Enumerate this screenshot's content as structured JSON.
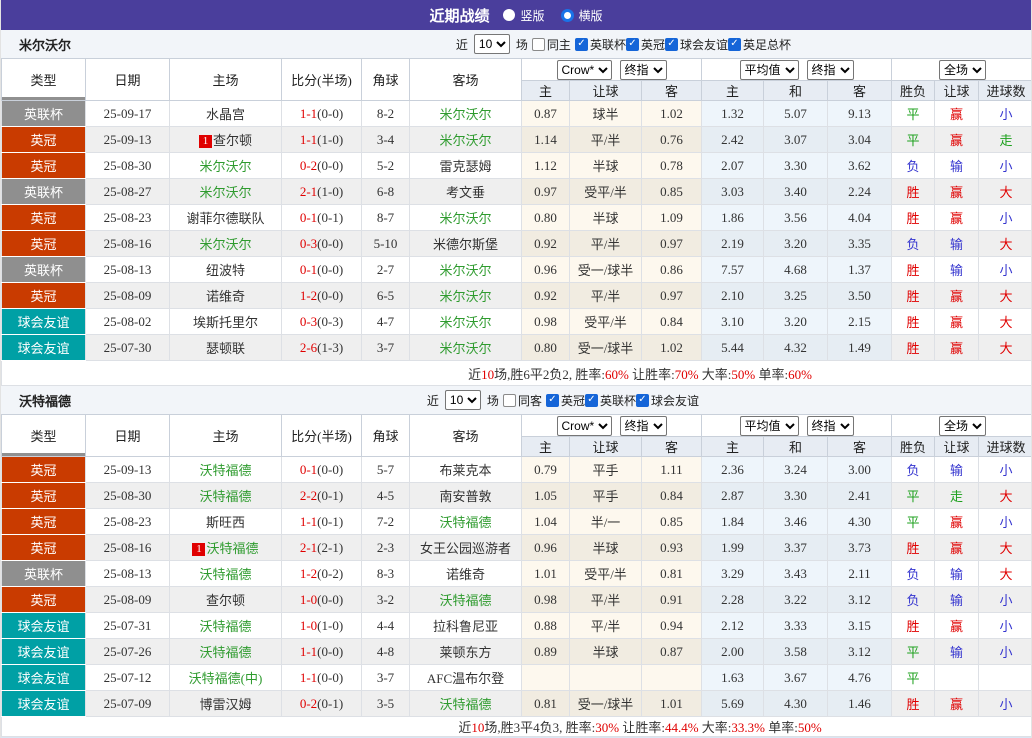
{
  "topbar": {
    "title": "近期战绩",
    "radio1": "竖版",
    "radio2": "横版"
  },
  "columns": [
    "类型",
    "日期",
    "主场",
    "比分(半场)",
    "角球",
    "客场"
  ],
  "subcolumns": [
    "主",
    "让球",
    "客",
    "主",
    "和",
    "客",
    "胜负",
    "让球",
    "进球数"
  ],
  "selects": {
    "odds_source": "Crow*",
    "final1": "终指",
    "average": "平均值",
    "final2": "终指",
    "scope": "全场",
    "recent_count": "10"
  },
  "filter_labels": {
    "recent": "近",
    "games": "场"
  },
  "league_colors": {
    "英联杯": "#8f8f8f",
    "英冠": "#c93b00",
    "球会友谊": "#00a0a5"
  },
  "result_colors": {
    "r": "#e00000",
    "g": "#1ca01c",
    "b": "#3434cf"
  },
  "accent_colors": {
    "topbar_purple": "#4a3e9c",
    "score_red": "#e00000",
    "team_green": "#2e9b2e",
    "checkbox_blue": "#1565d8"
  },
  "sections": [
    {
      "team": "米尔沃尔",
      "filter": {
        "same": "同主",
        "same_checked": false,
        "leagues": [
          "英联杯",
          "英冠",
          "球会友谊",
          "英足总杯"
        ]
      },
      "rows": [
        {
          "league": "英联杯",
          "date": "25-09-17",
          "home": {
            "name": "水晶宫",
            "green": false
          },
          "score": {
            "ft": "1-1",
            "ht": "(0-0)"
          },
          "corner": "8-2",
          "away": {
            "name": "米尔沃尔",
            "green": true
          },
          "crow": [
            "0.87",
            "球半",
            "1.02"
          ],
          "avg": [
            "1.32",
            "5.07",
            "9.13"
          ],
          "outcome": [
            {
              "t": "平",
              "c": "g"
            },
            {
              "t": "赢",
              "c": "r"
            },
            {
              "t": "小",
              "c": "b"
            }
          ]
        },
        {
          "league": "英冠",
          "date": "25-09-13",
          "home": {
            "name": "查尔顿",
            "green": false,
            "badge": "1"
          },
          "score": {
            "ft": "1-1",
            "ht": "(1-0)"
          },
          "corner": "3-4",
          "away": {
            "name": "米尔沃尔",
            "green": true
          },
          "crow": [
            "1.14",
            "平/半",
            "0.76"
          ],
          "avg": [
            "2.42",
            "3.07",
            "3.04"
          ],
          "outcome": [
            {
              "t": "平",
              "c": "g"
            },
            {
              "t": "赢",
              "c": "r"
            },
            {
              "t": "走",
              "c": "g"
            }
          ]
        },
        {
          "league": "英冠",
          "date": "25-08-30",
          "home": {
            "name": "米尔沃尔",
            "green": true
          },
          "score": {
            "ft": "0-2",
            "ht": "(0-0)"
          },
          "corner": "5-2",
          "away": {
            "name": "雷克瑟姆",
            "green": false
          },
          "crow": [
            "1.12",
            "半球",
            "0.78"
          ],
          "avg": [
            "2.07",
            "3.30",
            "3.62"
          ],
          "outcome": [
            {
              "t": "负",
              "c": "b"
            },
            {
              "t": "输",
              "c": "b"
            },
            {
              "t": "小",
              "c": "b"
            }
          ]
        },
        {
          "league": "英联杯",
          "date": "25-08-27",
          "home": {
            "name": "米尔沃尔",
            "green": true
          },
          "score": {
            "ft": "2-1",
            "ht": "(1-0)"
          },
          "corner": "6-8",
          "away": {
            "name": "考文垂",
            "green": false
          },
          "crow": [
            "0.97",
            "受平/半",
            "0.85"
          ],
          "avg": [
            "3.03",
            "3.40",
            "2.24"
          ],
          "outcome": [
            {
              "t": "胜",
              "c": "r"
            },
            {
              "t": "赢",
              "c": "r"
            },
            {
              "t": "大",
              "c": "r"
            }
          ]
        },
        {
          "league": "英冠",
          "date": "25-08-23",
          "home": {
            "name": "谢菲尔德联队",
            "green": false
          },
          "score": {
            "ft": "0-1",
            "ht": "(0-1)"
          },
          "corner": "8-7",
          "away": {
            "name": "米尔沃尔",
            "green": true
          },
          "crow": [
            "0.80",
            "半球",
            "1.09"
          ],
          "avg": [
            "1.86",
            "3.56",
            "4.04"
          ],
          "outcome": [
            {
              "t": "胜",
              "c": "r"
            },
            {
              "t": "赢",
              "c": "r"
            },
            {
              "t": "小",
              "c": "b"
            }
          ]
        },
        {
          "league": "英冠",
          "date": "25-08-16",
          "home": {
            "name": "米尔沃尔",
            "green": true
          },
          "score": {
            "ft": "0-3",
            "ht": "(0-0)"
          },
          "corner": "5-10",
          "away": {
            "name": "米德尔斯堡",
            "green": false
          },
          "crow": [
            "0.92",
            "平/半",
            "0.97"
          ],
          "avg": [
            "2.19",
            "3.20",
            "3.35"
          ],
          "outcome": [
            {
              "t": "负",
              "c": "b"
            },
            {
              "t": "输",
              "c": "b"
            },
            {
              "t": "大",
              "c": "r"
            }
          ]
        },
        {
          "league": "英联杯",
          "date": "25-08-13",
          "home": {
            "name": "纽波特",
            "green": false
          },
          "score": {
            "ft": "0-1",
            "ht": "(0-0)"
          },
          "corner": "2-7",
          "away": {
            "name": "米尔沃尔",
            "green": true
          },
          "crow": [
            "0.96",
            "受一/球半",
            "0.86"
          ],
          "avg": [
            "7.57",
            "4.68",
            "1.37"
          ],
          "outcome": [
            {
              "t": "胜",
              "c": "r"
            },
            {
              "t": "输",
              "c": "b"
            },
            {
              "t": "小",
              "c": "b"
            }
          ]
        },
        {
          "league": "英冠",
          "date": "25-08-09",
          "home": {
            "name": "诺维奇",
            "green": false
          },
          "score": {
            "ft": "1-2",
            "ht": "(0-0)"
          },
          "corner": "6-5",
          "away": {
            "name": "米尔沃尔",
            "green": true
          },
          "crow": [
            "0.92",
            "平/半",
            "0.97"
          ],
          "avg": [
            "2.10",
            "3.25",
            "3.50"
          ],
          "outcome": [
            {
              "t": "胜",
              "c": "r"
            },
            {
              "t": "赢",
              "c": "r"
            },
            {
              "t": "大",
              "c": "r"
            }
          ]
        },
        {
          "league": "球会友谊",
          "date": "25-08-02",
          "home": {
            "name": "埃斯托里尔",
            "green": false
          },
          "score": {
            "ft": "0-3",
            "ht": "(0-3)"
          },
          "corner": "4-7",
          "away": {
            "name": "米尔沃尔",
            "green": true
          },
          "crow": [
            "0.98",
            "受平/半",
            "0.84"
          ],
          "avg": [
            "3.10",
            "3.20",
            "2.15"
          ],
          "outcome": [
            {
              "t": "胜",
              "c": "r"
            },
            {
              "t": "赢",
              "c": "r"
            },
            {
              "t": "大",
              "c": "r"
            }
          ]
        },
        {
          "league": "球会友谊",
          "date": "25-07-30",
          "home": {
            "name": "瑟顿联",
            "green": false
          },
          "score": {
            "ft": "2-6",
            "ht": "(1-3)"
          },
          "corner": "3-7",
          "away": {
            "name": "米尔沃尔",
            "green": true
          },
          "crow": [
            "0.80",
            "受一/球半",
            "1.02"
          ],
          "avg": [
            "5.44",
            "4.32",
            "1.49"
          ],
          "outcome": [
            {
              "t": "胜",
              "c": "r"
            },
            {
              "t": "赢",
              "c": "r"
            },
            {
              "t": "大",
              "c": "r"
            }
          ]
        }
      ],
      "summary": [
        {
          "t": "近"
        },
        {
          "t": "10",
          "red": true
        },
        {
          "t": "场,胜6平2负2, 胜率:"
        },
        {
          "t": "60%",
          "red": true
        },
        {
          "t": " 让胜率:"
        },
        {
          "t": "70%",
          "red": true
        },
        {
          "t": " 大率:"
        },
        {
          "t": "50%",
          "red": true
        },
        {
          "t": " 单率:"
        },
        {
          "t": "60%",
          "red": true
        }
      ]
    },
    {
      "team": "沃特福德",
      "filter": {
        "same": "同客",
        "same_checked": false,
        "leagues": [
          "英冠",
          "英联杯",
          "球会友谊"
        ]
      },
      "rows": [
        {
          "league": "英冠",
          "date": "25-09-13",
          "home": {
            "name": "沃特福德",
            "green": true
          },
          "score": {
            "ft": "0-1",
            "ht": "(0-0)"
          },
          "corner": "5-7",
          "away": {
            "name": "布莱克本",
            "green": false
          },
          "crow": [
            "0.79",
            "平手",
            "1.11"
          ],
          "avg": [
            "2.36",
            "3.24",
            "3.00"
          ],
          "outcome": [
            {
              "t": "负",
              "c": "b"
            },
            {
              "t": "输",
              "c": "b"
            },
            {
              "t": "小",
              "c": "b"
            }
          ]
        },
        {
          "league": "英冠",
          "date": "25-08-30",
          "home": {
            "name": "沃特福德",
            "green": true
          },
          "score": {
            "ft": "2-2",
            "ht": "(0-1)"
          },
          "corner": "4-5",
          "away": {
            "name": "南安普敦",
            "green": false
          },
          "crow": [
            "1.05",
            "平手",
            "0.84"
          ],
          "avg": [
            "2.87",
            "3.30",
            "2.41"
          ],
          "outcome": [
            {
              "t": "平",
              "c": "g"
            },
            {
              "t": "走",
              "c": "g"
            },
            {
              "t": "大",
              "c": "r"
            }
          ]
        },
        {
          "league": "英冠",
          "date": "25-08-23",
          "home": {
            "name": "斯旺西",
            "green": false
          },
          "score": {
            "ft": "1-1",
            "ht": "(0-1)"
          },
          "corner": "7-2",
          "away": {
            "name": "沃特福德",
            "green": true
          },
          "crow": [
            "1.04",
            "半/一",
            "0.85"
          ],
          "avg": [
            "1.84",
            "3.46",
            "4.30"
          ],
          "outcome": [
            {
              "t": "平",
              "c": "g"
            },
            {
              "t": "赢",
              "c": "r"
            },
            {
              "t": "小",
              "c": "b"
            }
          ]
        },
        {
          "league": "英冠",
          "date": "25-08-16",
          "home": {
            "name": "沃特福德",
            "green": true,
            "badge": "1"
          },
          "score": {
            "ft": "2-1",
            "ht": "(2-1)"
          },
          "corner": "2-3",
          "away": {
            "name": "女王公园巡游者",
            "green": false
          },
          "crow": [
            "0.96",
            "半球",
            "0.93"
          ],
          "avg": [
            "1.99",
            "3.37",
            "3.73"
          ],
          "outcome": [
            {
              "t": "胜",
              "c": "r"
            },
            {
              "t": "赢",
              "c": "r"
            },
            {
              "t": "大",
              "c": "r"
            }
          ]
        },
        {
          "league": "英联杯",
          "date": "25-08-13",
          "home": {
            "name": "沃特福德",
            "green": true
          },
          "score": {
            "ft": "1-2",
            "ht": "(0-2)"
          },
          "corner": "8-3",
          "away": {
            "name": "诺维奇",
            "green": false
          },
          "crow": [
            "1.01",
            "受平/半",
            "0.81"
          ],
          "avg": [
            "3.29",
            "3.43",
            "2.11"
          ],
          "outcome": [
            {
              "t": "负",
              "c": "b"
            },
            {
              "t": "输",
              "c": "b"
            },
            {
              "t": "大",
              "c": "r"
            }
          ]
        },
        {
          "league": "英冠",
          "date": "25-08-09",
          "home": {
            "name": "查尔顿",
            "green": false
          },
          "score": {
            "ft": "1-0",
            "ht": "(0-0)"
          },
          "corner": "3-2",
          "away": {
            "name": "沃特福德",
            "green": true
          },
          "crow": [
            "0.98",
            "平/半",
            "0.91"
          ],
          "avg": [
            "2.28",
            "3.22",
            "3.12"
          ],
          "outcome": [
            {
              "t": "负",
              "c": "b"
            },
            {
              "t": "输",
              "c": "b"
            },
            {
              "t": "小",
              "c": "b"
            }
          ]
        },
        {
          "league": "球会友谊",
          "date": "25-07-31",
          "home": {
            "name": "沃特福德",
            "green": true
          },
          "score": {
            "ft": "1-0",
            "ht": "(1-0)"
          },
          "corner": "4-4",
          "away": {
            "name": "拉科鲁尼亚",
            "green": false
          },
          "crow": [
            "0.88",
            "平/半",
            "0.94"
          ],
          "avg": [
            "2.12",
            "3.33",
            "3.15"
          ],
          "outcome": [
            {
              "t": "胜",
              "c": "r"
            },
            {
              "t": "赢",
              "c": "r"
            },
            {
              "t": "小",
              "c": "b"
            }
          ]
        },
        {
          "league": "球会友谊",
          "date": "25-07-26",
          "home": {
            "name": "沃特福德",
            "green": true
          },
          "score": {
            "ft": "1-1",
            "ht": "(0-0)"
          },
          "corner": "4-8",
          "away": {
            "name": "莱顿东方",
            "green": false
          },
          "crow": [
            "0.89",
            "半球",
            "0.87"
          ],
          "avg": [
            "2.00",
            "3.58",
            "3.12"
          ],
          "outcome": [
            {
              "t": "平",
              "c": "g"
            },
            {
              "t": "输",
              "c": "b"
            },
            {
              "t": "小",
              "c": "b"
            }
          ]
        },
        {
          "league": "球会友谊",
          "date": "25-07-12",
          "home": {
            "name": "沃特福德(中)",
            "green": true
          },
          "score": {
            "ft": "1-1",
            "ht": "(0-0)"
          },
          "corner": "3-7",
          "away": {
            "name": "AFC温布尔登",
            "green": false
          },
          "crow": [
            "",
            "",
            ""
          ],
          "avg": [
            "1.63",
            "3.67",
            "4.76"
          ],
          "outcome": [
            {
              "t": "平",
              "c": "g"
            },
            {
              "t": "",
              "c": ""
            },
            {
              "t": "",
              "c": ""
            }
          ]
        },
        {
          "league": "球会友谊",
          "date": "25-07-09",
          "home": {
            "name": "博雷汉姆",
            "green": false
          },
          "score": {
            "ft": "0-2",
            "ht": "(0-1)"
          },
          "corner": "3-5",
          "away": {
            "name": "沃特福德",
            "green": true
          },
          "crow": [
            "0.81",
            "受一/球半",
            "1.01"
          ],
          "avg": [
            "5.69",
            "4.30",
            "1.46"
          ],
          "outcome": [
            {
              "t": "胜",
              "c": "r"
            },
            {
              "t": "赢",
              "c": "r"
            },
            {
              "t": "小",
              "c": "b"
            }
          ]
        }
      ],
      "summary": [
        {
          "t": "近"
        },
        {
          "t": "10",
          "red": true
        },
        {
          "t": "场,胜3平4负3, 胜率:"
        },
        {
          "t": "30%",
          "red": true
        },
        {
          "t": " 让胜率:"
        },
        {
          "t": "44.4%",
          "red": true
        },
        {
          "t": " 大率:"
        },
        {
          "t": "33.3%",
          "red": true
        },
        {
          "t": " 单率:"
        },
        {
          "t": "50%",
          "red": true
        }
      ]
    }
  ]
}
